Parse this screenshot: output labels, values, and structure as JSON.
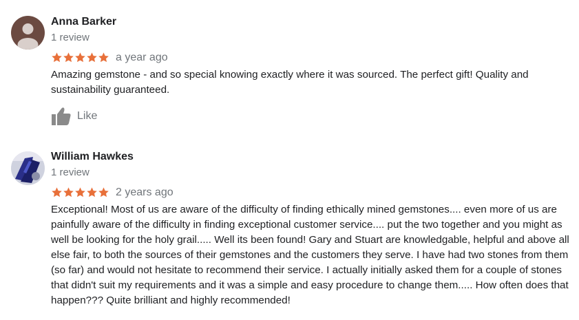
{
  "colors": {
    "star": "#e8703a",
    "muted": "#70757a",
    "text": "#202124"
  },
  "reviews": [
    {
      "name": "Anna Barker",
      "count": "1 review",
      "rating": 5,
      "date": "a year ago",
      "text": "Amazing gemstone - and so special knowing exactly where it was sourced. The perfect gift! Quality and sustainability guaranteed.",
      "like_label": "Like",
      "like_icon": "thumbs-up-icon"
    },
    {
      "name": "William Hawkes",
      "count": "1 review",
      "rating": 5,
      "date": "2 years ago",
      "text": "Exceptional! Most of us are aware of the difficulty of finding ethically mined gemstones.... even more of us are painfully aware of the difficulty in finding exceptional customer service.... put the two together and you might as well be looking for the holy grail..... Well its been found! Gary and Stuart are knowledgable, helpful and above all else fair, to both the sources of their gemstones and the customers they serve. I have had two stones from them (so far) and would not hesitate to recommend their service. I actually initially asked them for a couple of stones that didn't suit my requirements and it was a simple and easy procedure to change them..... How often does that happen??? Quite brilliant and highly recommended!"
    }
  ]
}
